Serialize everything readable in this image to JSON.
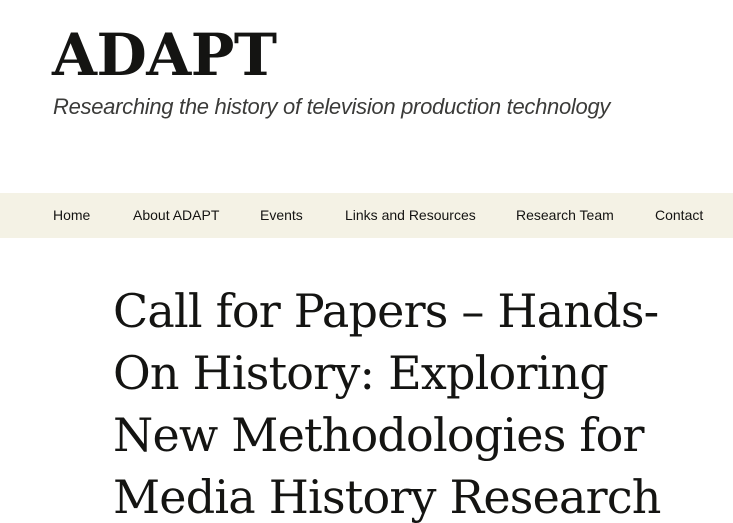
{
  "site": {
    "title": "ADAPT",
    "description": "Researching the history of television production technology"
  },
  "nav": {
    "items": [
      {
        "label": "Home"
      },
      {
        "label": "About ADAPT"
      },
      {
        "label": "Events"
      },
      {
        "label": "Links and Resources"
      },
      {
        "label": "Research Team"
      },
      {
        "label": "Contact"
      }
    ]
  },
  "post": {
    "title": "Call for Papers – Hands-On History: Exploring New Methodologies for Media History Research"
  },
  "colors": {
    "nav_background": "#f4f2e5",
    "text": "#141412"
  }
}
